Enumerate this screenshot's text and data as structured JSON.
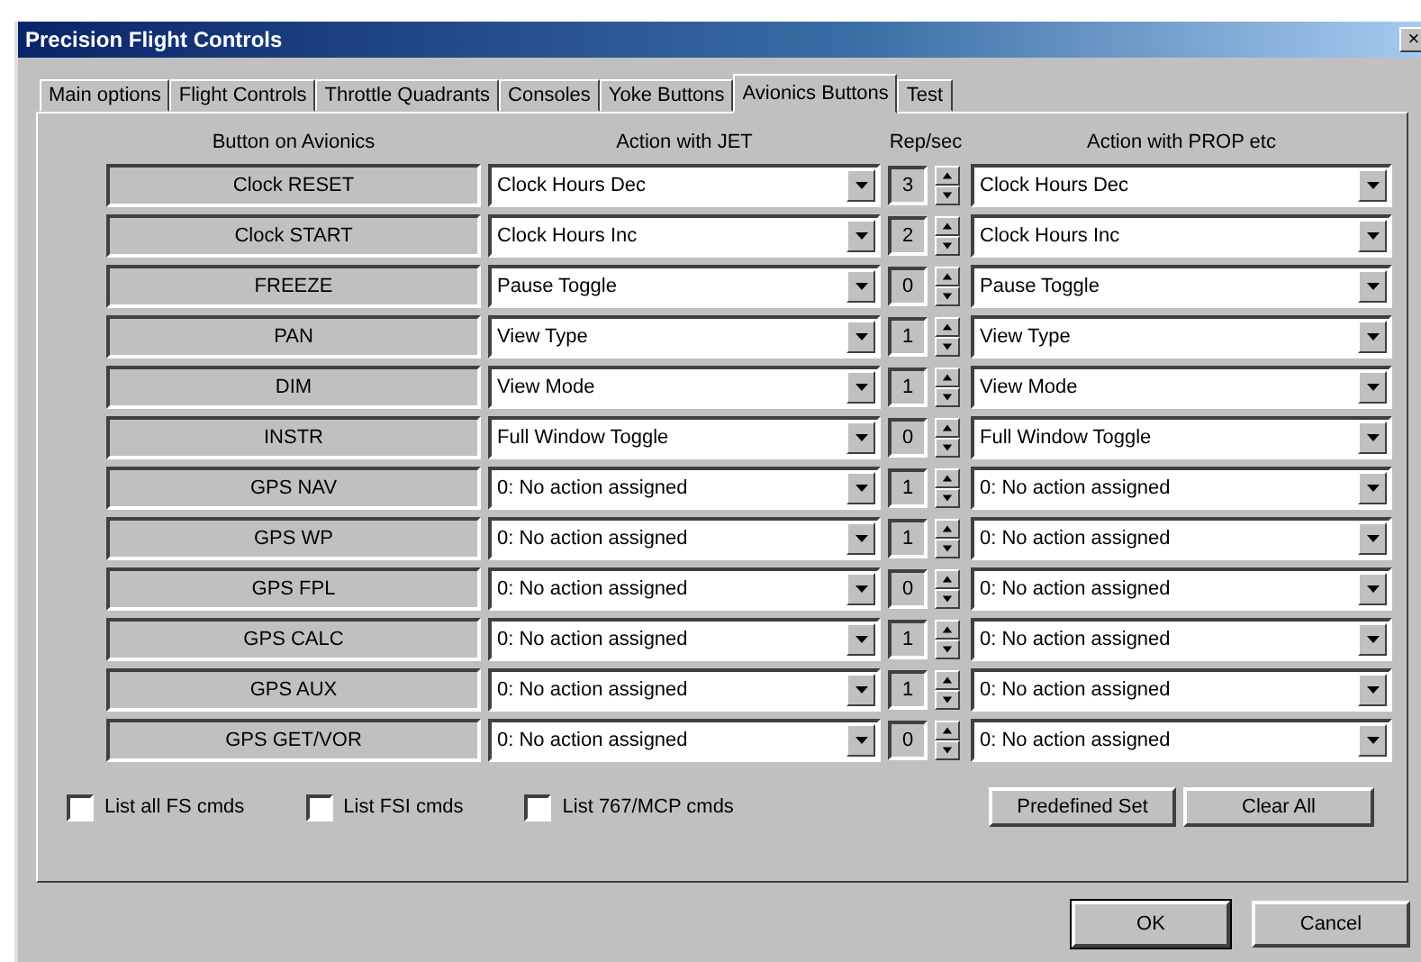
{
  "window": {
    "title": "Precision Flight Controls",
    "close": "×"
  },
  "tabs": [
    {
      "label": "Main options",
      "selected": false
    },
    {
      "label": "Flight Controls",
      "selected": false
    },
    {
      "label": "Throttle Quadrants",
      "selected": false
    },
    {
      "label": "Consoles",
      "selected": false
    },
    {
      "label": "Yoke Buttons",
      "selected": false
    },
    {
      "label": "Avionics Buttons",
      "selected": true
    },
    {
      "label": "Test",
      "selected": false
    }
  ],
  "table": {
    "columns": [
      "Button on Avionics",
      "Action with JET",
      "Rep/sec",
      "Action with PROP etc"
    ],
    "rows": [
      {
        "button": "Clock RESET",
        "jet_action": "Clock Hours Dec",
        "rep": "3",
        "prop_action": "Clock Hours Dec"
      },
      {
        "button": "Clock START",
        "jet_action": "Clock Hours Inc",
        "rep": "2",
        "prop_action": "Clock Hours Inc"
      },
      {
        "button": "FREEZE",
        "jet_action": "Pause Toggle",
        "rep": "0",
        "prop_action": "Pause Toggle"
      },
      {
        "button": "PAN",
        "jet_action": "View Type",
        "rep": "1",
        "prop_action": "View Type"
      },
      {
        "button": "DIM",
        "jet_action": "View Mode",
        "rep": "1",
        "prop_action": "View Mode"
      },
      {
        "button": "INSTR",
        "jet_action": "Full Window Toggle",
        "rep": "0",
        "prop_action": "Full Window Toggle"
      },
      {
        "button": "GPS NAV",
        "jet_action": "0: No action assigned",
        "rep": "1",
        "prop_action": "0: No action assigned"
      },
      {
        "button": "GPS WP",
        "jet_action": "0: No action assigned",
        "rep": "1",
        "prop_action": "0: No action assigned"
      },
      {
        "button": "GPS FPL",
        "jet_action": "0: No action assigned",
        "rep": "0",
        "prop_action": "0: No action assigned"
      },
      {
        "button": "GPS CALC",
        "jet_action": "0: No action assigned",
        "rep": "1",
        "prop_action": "0: No action assigned"
      },
      {
        "button": "GPS AUX",
        "jet_action": "0: No action assigned",
        "rep": "1",
        "prop_action": "0: No action assigned"
      },
      {
        "button": "GPS GET/VOR",
        "jet_action": "0: No action assigned",
        "rep": "0",
        "prop_action": "0: No action assigned"
      }
    ]
  },
  "options": [
    {
      "label": "List all FS cmds",
      "checked": false
    },
    {
      "label": "List FSI cmds",
      "checked": false
    },
    {
      "label": "List 767/MCP cmds",
      "checked": false
    }
  ],
  "panel_buttons": [
    "Predefined Set",
    "Clear All"
  ],
  "dialog_buttons": [
    "OK",
    "Cancel"
  ]
}
